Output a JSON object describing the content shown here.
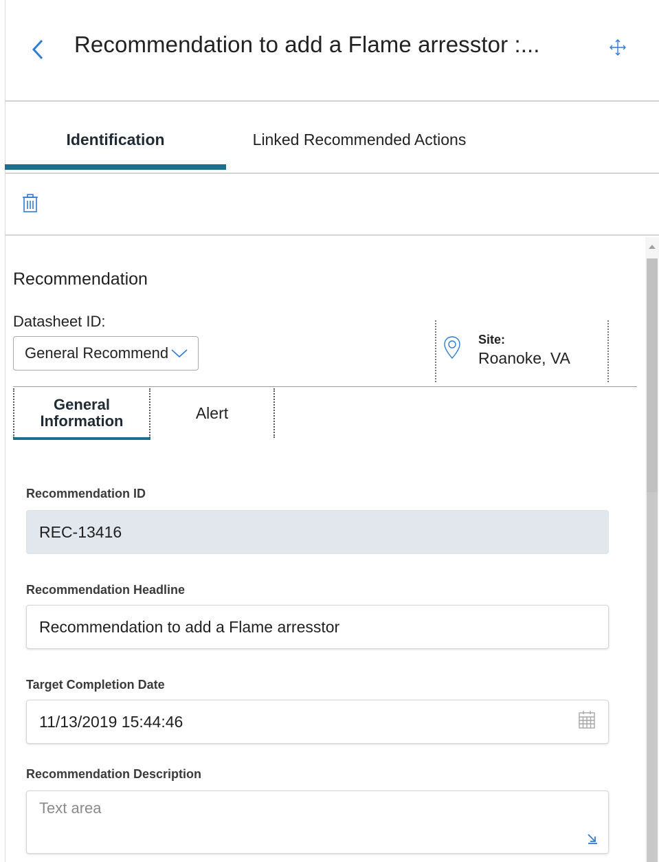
{
  "header": {
    "title": "Recommendation to add a Flame arresstor :..."
  },
  "tabs": [
    {
      "label": "Identification",
      "active": true
    },
    {
      "label": "Linked Recommended Actions",
      "active": false
    }
  ],
  "toolbar": {
    "delete_icon": "trash-icon"
  },
  "section": {
    "title": "Recommendation"
  },
  "datasheet": {
    "label": "Datasheet ID:",
    "selected": "General Recommendation"
  },
  "site": {
    "label": "Site:",
    "value": "Roanoke, VA",
    "icon": "location-pin-icon"
  },
  "subtabs": [
    {
      "label": "General Information",
      "active": true
    },
    {
      "label": "Alert",
      "active": false
    }
  ],
  "fields": {
    "rec_id": {
      "label": "Recommendation ID",
      "value": "REC-13416"
    },
    "headline": {
      "label": "Recommendation Headline",
      "value": "Recommendation to add a Flame arresstor"
    },
    "target_date": {
      "label": "Target Completion Date",
      "value": "11/13/2019 15:44:46"
    },
    "description": {
      "label": "Recommendation Description",
      "placeholder": "Text area"
    }
  },
  "colors": {
    "accent": "#1a6f8a",
    "icon_blue": "#2e7bd6",
    "readonly_bg": "#e2e7ed"
  }
}
